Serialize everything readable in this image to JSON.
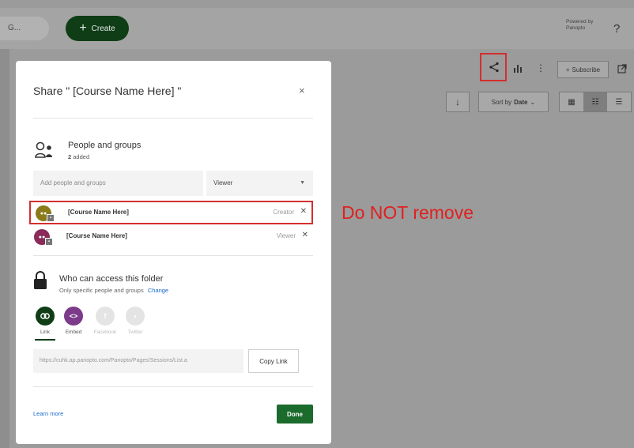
{
  "header": {
    "search_placeholder": "G...",
    "create_label": "Create",
    "powered_by_line1": "Powered by",
    "powered_by_line2": "Panopto",
    "help_label": "?"
  },
  "toolbar": {
    "subscribe_label": "Subscribe",
    "sort_prefix": "Sort by",
    "sort_value": "Date"
  },
  "annotation": {
    "text": "Do NOT remove",
    "color": "#e02020"
  },
  "modal": {
    "title": "Share \" [Course Name Here] \"",
    "close_label": "×",
    "people": {
      "title": "People and groups",
      "count": "2",
      "count_suffix": "added",
      "add_placeholder": "Add people and groups",
      "role_value": "Viewer"
    },
    "members": [
      {
        "name": "[Course Name Here]",
        "role": "Creator",
        "remove": "✕",
        "avatar_color": "#8a7a1a",
        "highlighted": true
      },
      {
        "name": "[Course Name Here]",
        "role": "Viewer",
        "remove": "✕",
        "avatar_color": "#8a2b5a",
        "highlighted": false
      }
    ],
    "access": {
      "title": "Who can access this folder",
      "subtitle": "Only specific people and groups",
      "change_label": "Change"
    },
    "share_options": [
      {
        "label": "Link",
        "icon": "link-icon",
        "color": "#0e3d16"
      },
      {
        "label": "Embed",
        "icon": "embed-icon",
        "color": "#7b3a8a"
      },
      {
        "label": "Facebook",
        "icon": "facebook-icon",
        "color": "#e4e4e4"
      },
      {
        "label": "Twitter",
        "icon": "twitter-icon",
        "color": "#e4e4e4"
      }
    ],
    "link_url": "https://cuhk.ap.panopto.com/Panopto/Pages/Sessions/List.a",
    "copy_link_label": "Copy Link",
    "learn_more_label": "Learn more",
    "done_label": "Done"
  }
}
